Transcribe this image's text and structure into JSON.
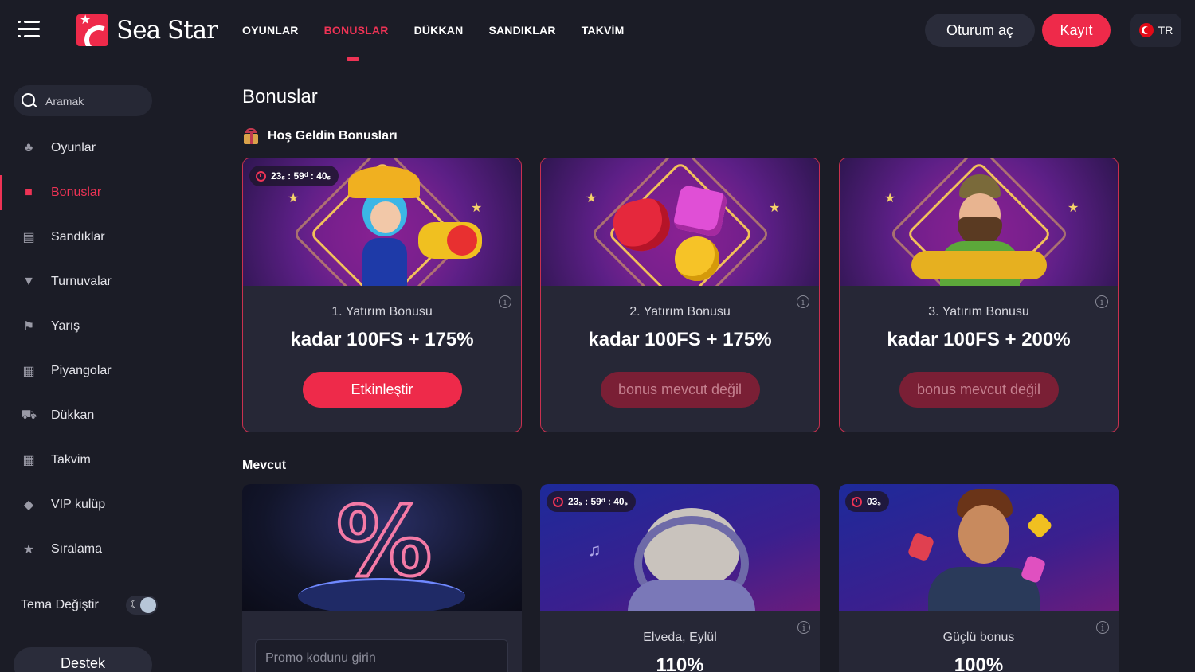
{
  "header": {
    "logo_text": "Sea Star",
    "nav": [
      {
        "label": "OYUNLAR"
      },
      {
        "label": "BONUSLAR"
      },
      {
        "label": "DÜKKAN"
      },
      {
        "label": "SANDIKLAR"
      },
      {
        "label": "TAKVİM"
      }
    ],
    "active_nav": "BONUSLAR",
    "login_label": "Oturum aç",
    "register_label": "Kayıt",
    "language": "TR"
  },
  "sidebar": {
    "search_placeholder": "Aramak",
    "items": [
      {
        "label": "Oyunlar",
        "icon": "games-icon"
      },
      {
        "label": "Bonuslar",
        "icon": "gift-icon"
      },
      {
        "label": "Sandıklar",
        "icon": "chest-icon"
      },
      {
        "label": "Turnuvalar",
        "icon": "trophy-icon"
      },
      {
        "label": "Yarış",
        "icon": "flag-icon"
      },
      {
        "label": "Piyangolar",
        "icon": "lottery-icon"
      },
      {
        "label": "Dükkan",
        "icon": "cart-icon"
      },
      {
        "label": "Takvim",
        "icon": "calendar-icon"
      },
      {
        "label": "VIP kulüp",
        "icon": "diamond-icon"
      },
      {
        "label": "Sıralama",
        "icon": "star-icon"
      }
    ],
    "active_item": "Bonuslar",
    "theme_label": "Tema Değiştir",
    "support_label": "Destek"
  },
  "main": {
    "page_title": "Bonuslar",
    "welcome_section": "Hoş Geldin Bonusları",
    "welcome_cards": [
      {
        "timer": "23ₛ : 59ᵈ : 40ₛ",
        "label": "1. Yatırım Bonusu",
        "value": "kadar 100FS + 175%",
        "button": "Etkinleştir",
        "enabled": true
      },
      {
        "label": "2. Yatırım Bonusu",
        "value": "kadar 100FS + 175%",
        "button": "bonus mevcut değil",
        "enabled": false
      },
      {
        "label": "3. Yatırım Bonusu",
        "value": "kadar 100FS + 200%",
        "button": "bonus mevcut değil",
        "enabled": false
      }
    ],
    "available_section": "Mevcut",
    "available_cards": [
      {
        "promo_placeholder": "Promo kodunu girin"
      },
      {
        "timer": "23ₛ : 59ᵈ : 40ₛ",
        "label": "Elveda, Eylül",
        "value": "110%"
      },
      {
        "timer": "03ₛ",
        "label": "Güçlü bonus",
        "value": "100%"
      }
    ]
  },
  "colors": {
    "accent": "#ee2a4a",
    "background": "#1b1c26",
    "card": "#262736"
  }
}
